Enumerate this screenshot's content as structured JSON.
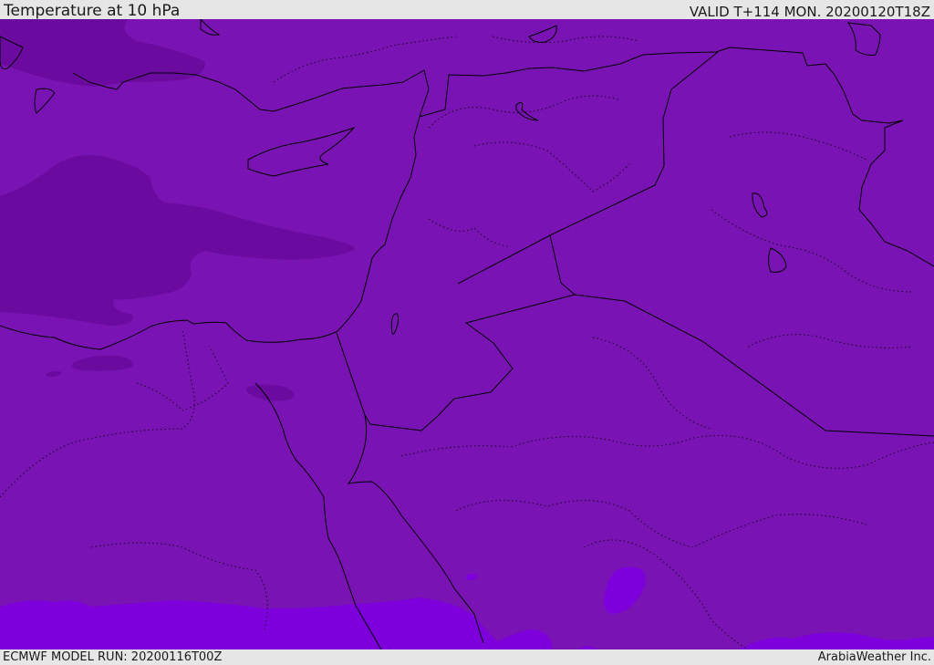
{
  "header": {
    "title": "Temperature at 10 hPa",
    "valid": "VALID T+114 MON. 20200120T18Z"
  },
  "footer": {
    "model_run": "ECMWF MODEL RUN: 20200116T00Z",
    "credit": "ArabiaWeather Inc."
  },
  "colors": {
    "background_field": "#7a13b3",
    "cold_region": "#6a0a9e",
    "warm_region": "#7d00dc",
    "coastline": "#000000",
    "header_bg": "#e6e6e6"
  }
}
